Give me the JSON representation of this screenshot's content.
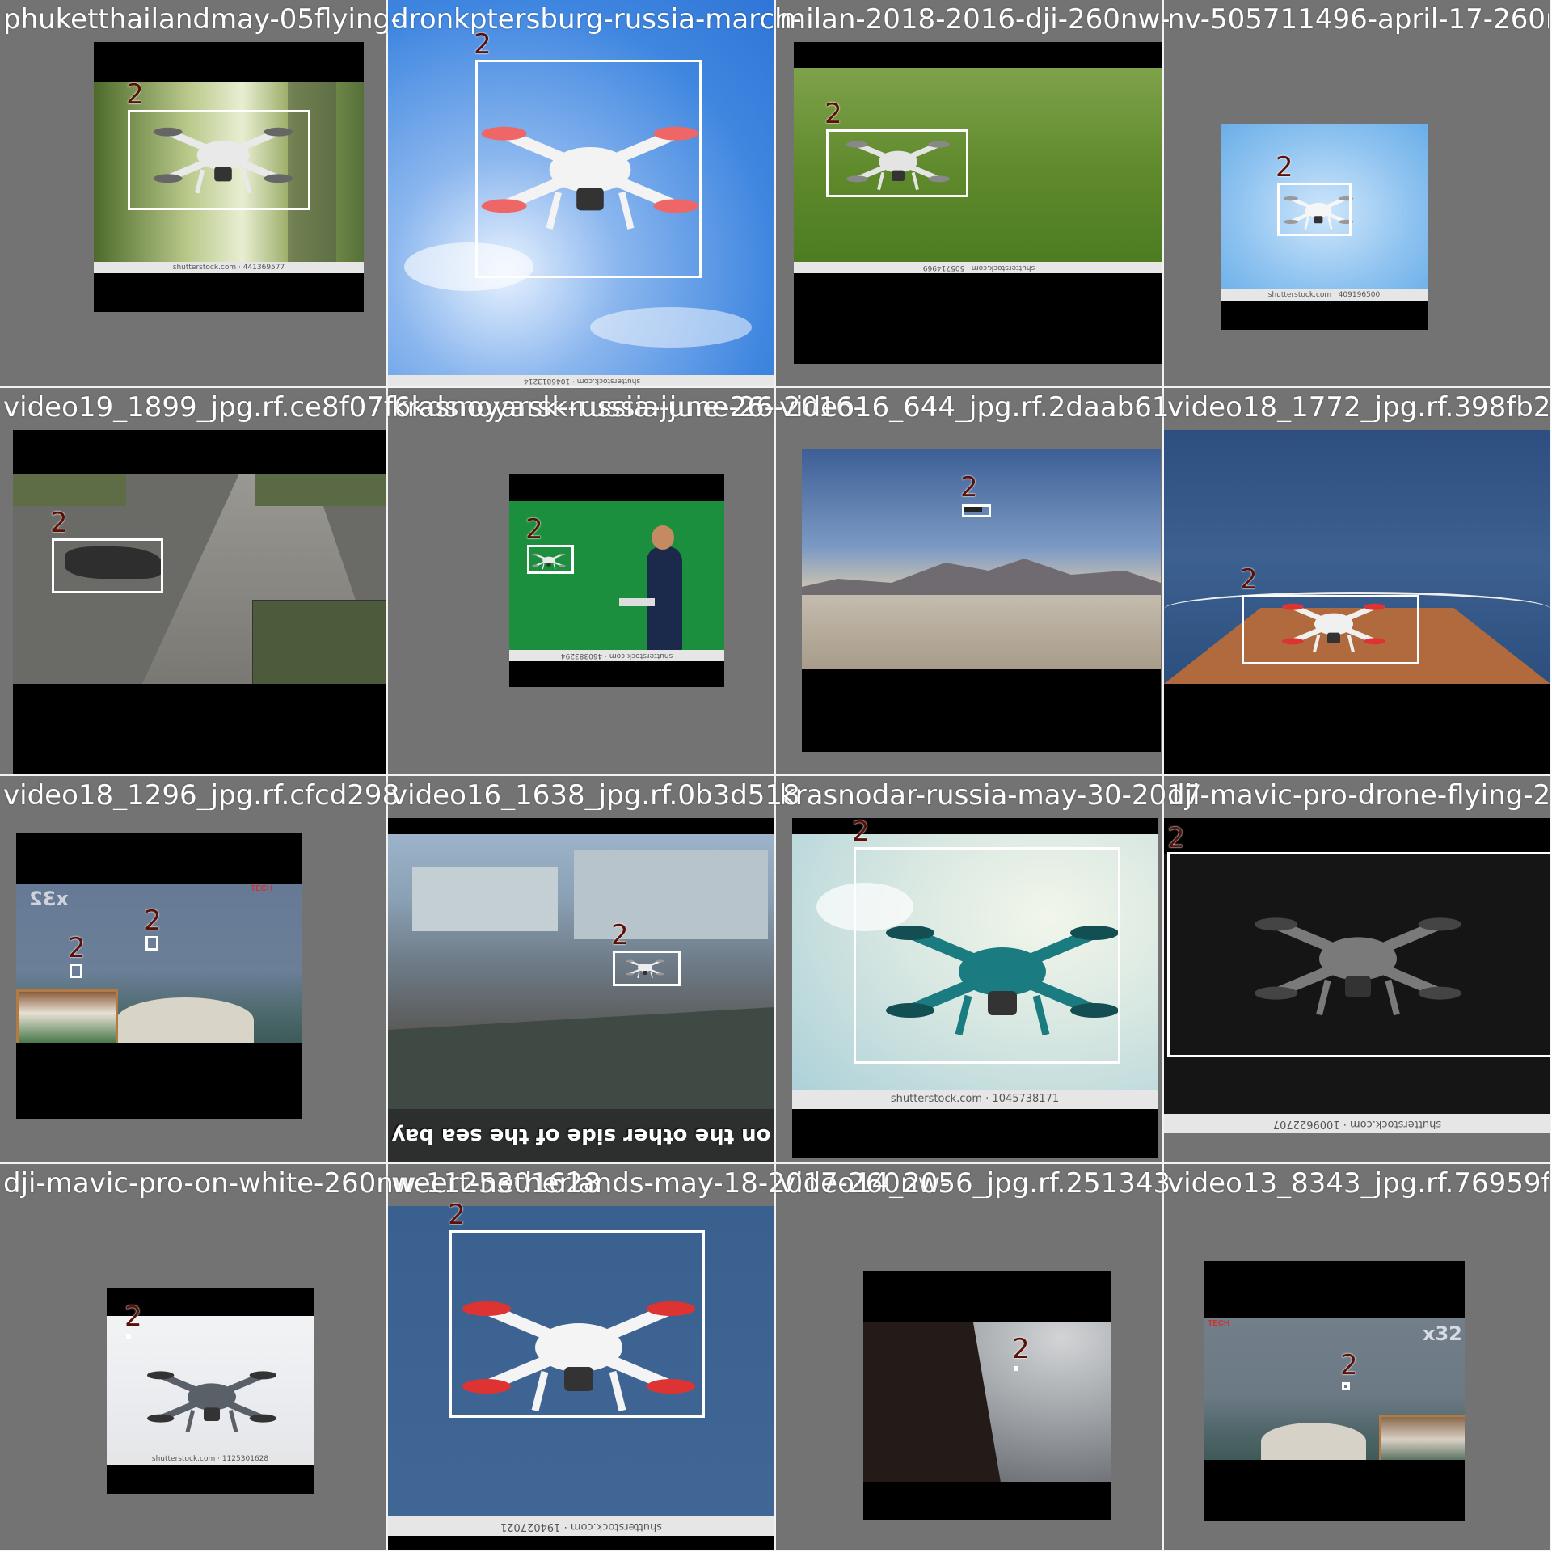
{
  "grid": {
    "columns": 4,
    "rows": 4,
    "tile_background": "#737373",
    "box_color": "#ffffff",
    "label_color": "#5a1208"
  },
  "tiles": [
    {
      "filename": "phuketthailandmay-05flying-",
      "label": "2",
      "scene": "drone-over-foliage",
      "watermark": "shutterstock.com · 441369577"
    },
    {
      "filename": "dronkptersburg-russia-march-",
      "label": "2",
      "scene": "drone-from-below-sky",
      "watermark": "shutterstock.com · 1046813214"
    },
    {
      "filename": "milan-2018-2016-dji-260nw-",
      "label": "2",
      "scene": "drone-over-grass",
      "watermark": "shutterstock.com · 505714969"
    },
    {
      "filename": "nv-505711496-april-17-260nw",
      "label": "2",
      "scene": "drone-blue-sky",
      "watermark": "shutterstock.com · 409196500"
    },
    {
      "filename": "video19_1899_jpg.rf.ce8f07f6kdsnoyarsk-russia-june-26-2016-",
      "label": "2",
      "scene": "folded-drone-gravel-road"
    },
    {
      "filename": "krasnoyarsk-russia-june-26-",
      "label": "2",
      "scene": "man-controller-green-screen",
      "watermark": "shutterstock.com · 460383294"
    },
    {
      "filename": "video16_644_jpg.rf.2daab61",
      "label": "2",
      "scene": "drone-desert-mountains"
    },
    {
      "filename": "video18_1772_jpg.rf.398fb2",
      "label": "2",
      "scene": "drone-on-boat-deck-sea"
    },
    {
      "filename": "video18_1296_jpg.rf.cfcd298",
      "label": "2",
      "label_2": "2",
      "scene": "sea-from-boat-x32",
      "overlay_text": "x32"
    },
    {
      "filename": "video16_1638_jpg.rf.0b3d518",
      "label": "2",
      "scene": "street-drone-caption",
      "caption": "on the other side of the sea bay"
    },
    {
      "filename": "krasnodar-russia-may-30-2017",
      "label": "2",
      "scene": "teal-drone-sky",
      "watermark": "shutterstock.com · 1045738171"
    },
    {
      "filename": "dji-mavic-pro-drone-flying-26",
      "label": "2",
      "scene": "mavic-dark-background",
      "watermark": "shutterstock.com · 1009622707"
    },
    {
      "filename": "dji-mavic-pro-on-white-260nw-1125301628",
      "label": "2",
      "scene": "mavic-on-white",
      "watermark": "shutterstock.com · 1125301628"
    },
    {
      "filename": "weert-netherlands-may-18-2017-260nw-",
      "label": "2",
      "scene": "white-quad-blue-sky",
      "watermark": "shutterstock.com · 194027021"
    },
    {
      "filename": "video14_2056_jpg.rf.251343",
      "label": "2",
      "scene": "building-fisheye-sky"
    },
    {
      "filename": "video13_8343_jpg.rf.76959f",
      "label": "2",
      "scene": "sea-boat-x32-tech",
      "overlay_text": "x32"
    }
  ]
}
